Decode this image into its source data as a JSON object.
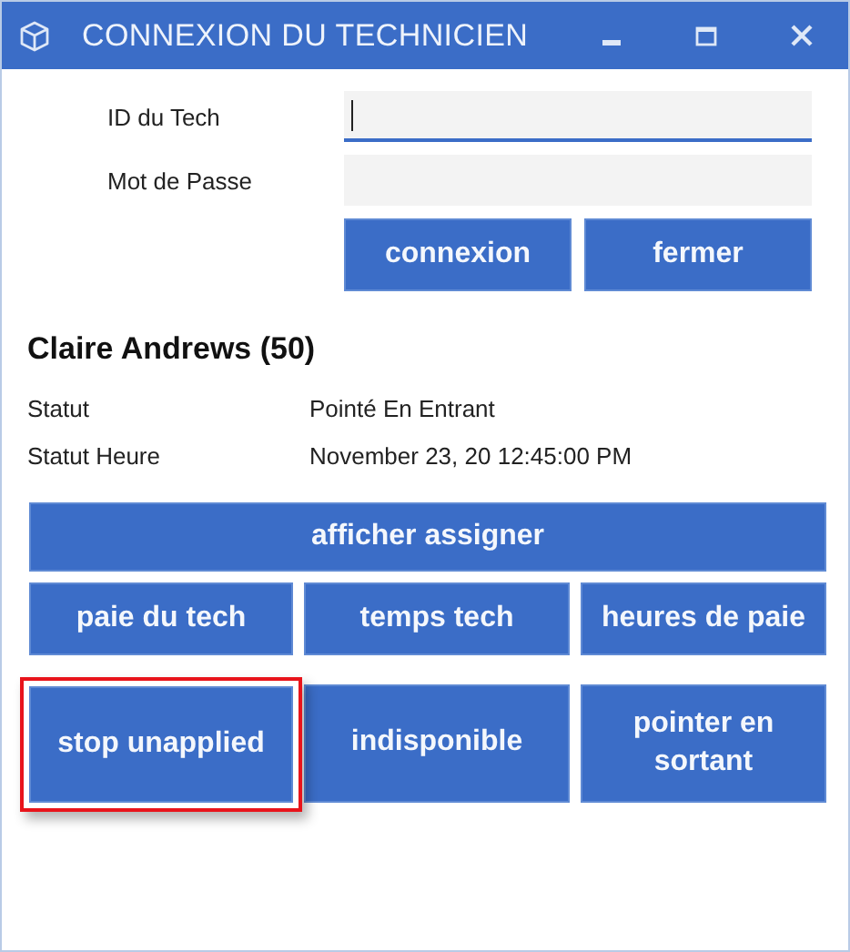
{
  "window": {
    "title": "CONNEXION DU TECHNICIEN"
  },
  "login": {
    "fields": [
      {
        "label": "ID du Tech",
        "focused": true
      },
      {
        "label": "Mot de Passe",
        "focused": false
      }
    ],
    "buttons": [
      "connexion",
      "fermer"
    ]
  },
  "technician": {
    "name": "Claire Andrews (50)",
    "details": [
      {
        "label": "Statut",
        "value": "Pointé En Entrant"
      },
      {
        "label": "Statut Heure",
        "value": "November 23, 20 12:45:00 PM"
      }
    ]
  },
  "actions": [
    [
      {
        "label": "afficher assigner",
        "highlighted": false
      }
    ],
    [
      {
        "label": "paie du tech",
        "highlighted": false
      },
      {
        "label": "temps tech",
        "highlighted": false
      },
      {
        "label": "heures de paie",
        "highlighted": false
      }
    ],
    [
      {
        "label": "stop unapplied",
        "highlighted": true
      },
      {
        "label": "indisponible",
        "highlighted": false
      },
      {
        "label": "pointer en sortant",
        "highlighted": false
      }
    ]
  ]
}
